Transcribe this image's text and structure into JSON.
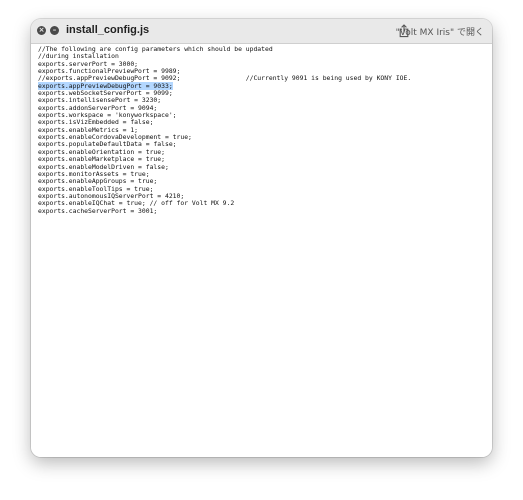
{
  "window": {
    "title": "install_config.js",
    "open_with_label": "\"Volt MX Iris\" で開く",
    "close_icon": "close-icon",
    "minimize_icon": "minimize-icon",
    "share_icon": "share-icon"
  },
  "editor": {
    "selected_line_index": 5,
    "lines": [
      "//The following are config parameters which should be updated",
      "//during installation",
      "exports.serverPort = 3000;",
      "exports.functionalPreviewPort = 9989;",
      "//exports.appPreviewDebugPort = 9092;                 //Currently 9091 is being used by KONY IOE.",
      "exports.appPreviewDebugPort = 9033;",
      "exports.webSocketServerPort = 9099;",
      "exports.intellisensePort = 3230;",
      "exports.addonServerPort = 9094;",
      "exports.workspace = 'konyworkspace';",
      "exports.isVizEmbedded = false;",
      "exports.enableMetrics = 1;",
      "exports.enableCordovaDevelopment = true;",
      "exports.populateDefaultData = false;",
      "exports.enableOrientation = true;",
      "exports.enableMarketplace = true;",
      "exports.enableModelDriven = false;",
      "exports.monitorAssets = true;",
      "exports.enableAppGroups = true;",
      "exports.enableToolTips = true;",
      "exports.autonomousIQServerPort = 4210;",
      "exports.enableIQChat = true; // off for Volt MX 9.2",
      "exports.cacheServerPort = 3001;"
    ]
  }
}
